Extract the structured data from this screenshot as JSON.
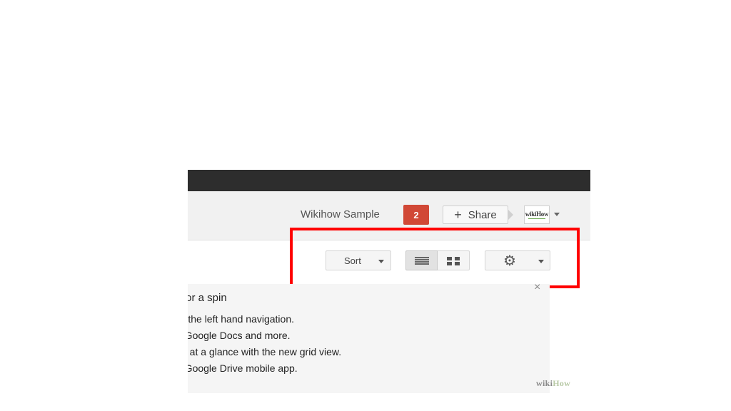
{
  "header": {
    "username": "Wikihow Sample",
    "notification_count": "2",
    "share_label": "Share",
    "share_icon": "plus-icon",
    "avatar_logo": "wikiHow"
  },
  "toolbar": {
    "sort_label": "Sort",
    "list_view_icon": "list-view-icon",
    "grid_view_icon": "grid-view-icon",
    "settings_icon": "gear-icon"
  },
  "promo": {
    "title": "for a spin",
    "items": [
      "re the left hand navigation.",
      "e Google Docs and more.",
      "es at a glance with the new grid view.",
      "e Google Drive mobile app."
    ],
    "close_glyph": "×"
  },
  "watermark": {
    "wiki": "wiki",
    "how": "How"
  },
  "colors": {
    "topbar": "#2d2d2d",
    "notification": "#d14836",
    "highlight": "#ff0000"
  }
}
